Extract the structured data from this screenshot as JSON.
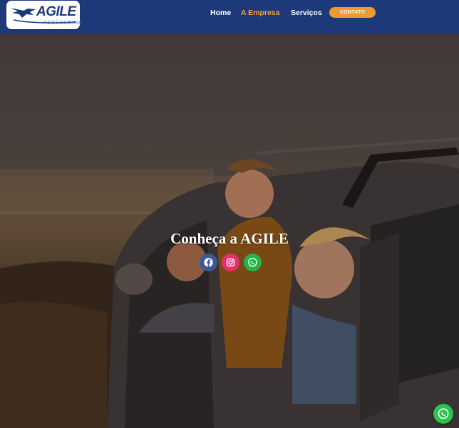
{
  "header": {
    "logo": {
      "name": "AGILE",
      "subtitle": "ASSESSORIA"
    },
    "nav": [
      {
        "label": "Home",
        "active": false
      },
      {
        "label": "A Empresa",
        "active": true
      },
      {
        "label": "Serviços",
        "active": false
      }
    ],
    "cta_label": "CONTATO"
  },
  "hero": {
    "title": "Conheça a AGILE",
    "social": [
      {
        "icon": "facebook-icon"
      },
      {
        "icon": "instagram-icon"
      },
      {
        "icon": "whatsapp-icon"
      }
    ]
  },
  "floating_button": {
    "icon": "whatsapp-icon"
  },
  "colors": {
    "header_bg": "#1c3a7a",
    "nav_active": "#f2a23a",
    "cta_bg": "#ee9a2e",
    "facebook": "#3b5998",
    "instagram": "#e1306c",
    "whatsapp": "#25b34a"
  }
}
